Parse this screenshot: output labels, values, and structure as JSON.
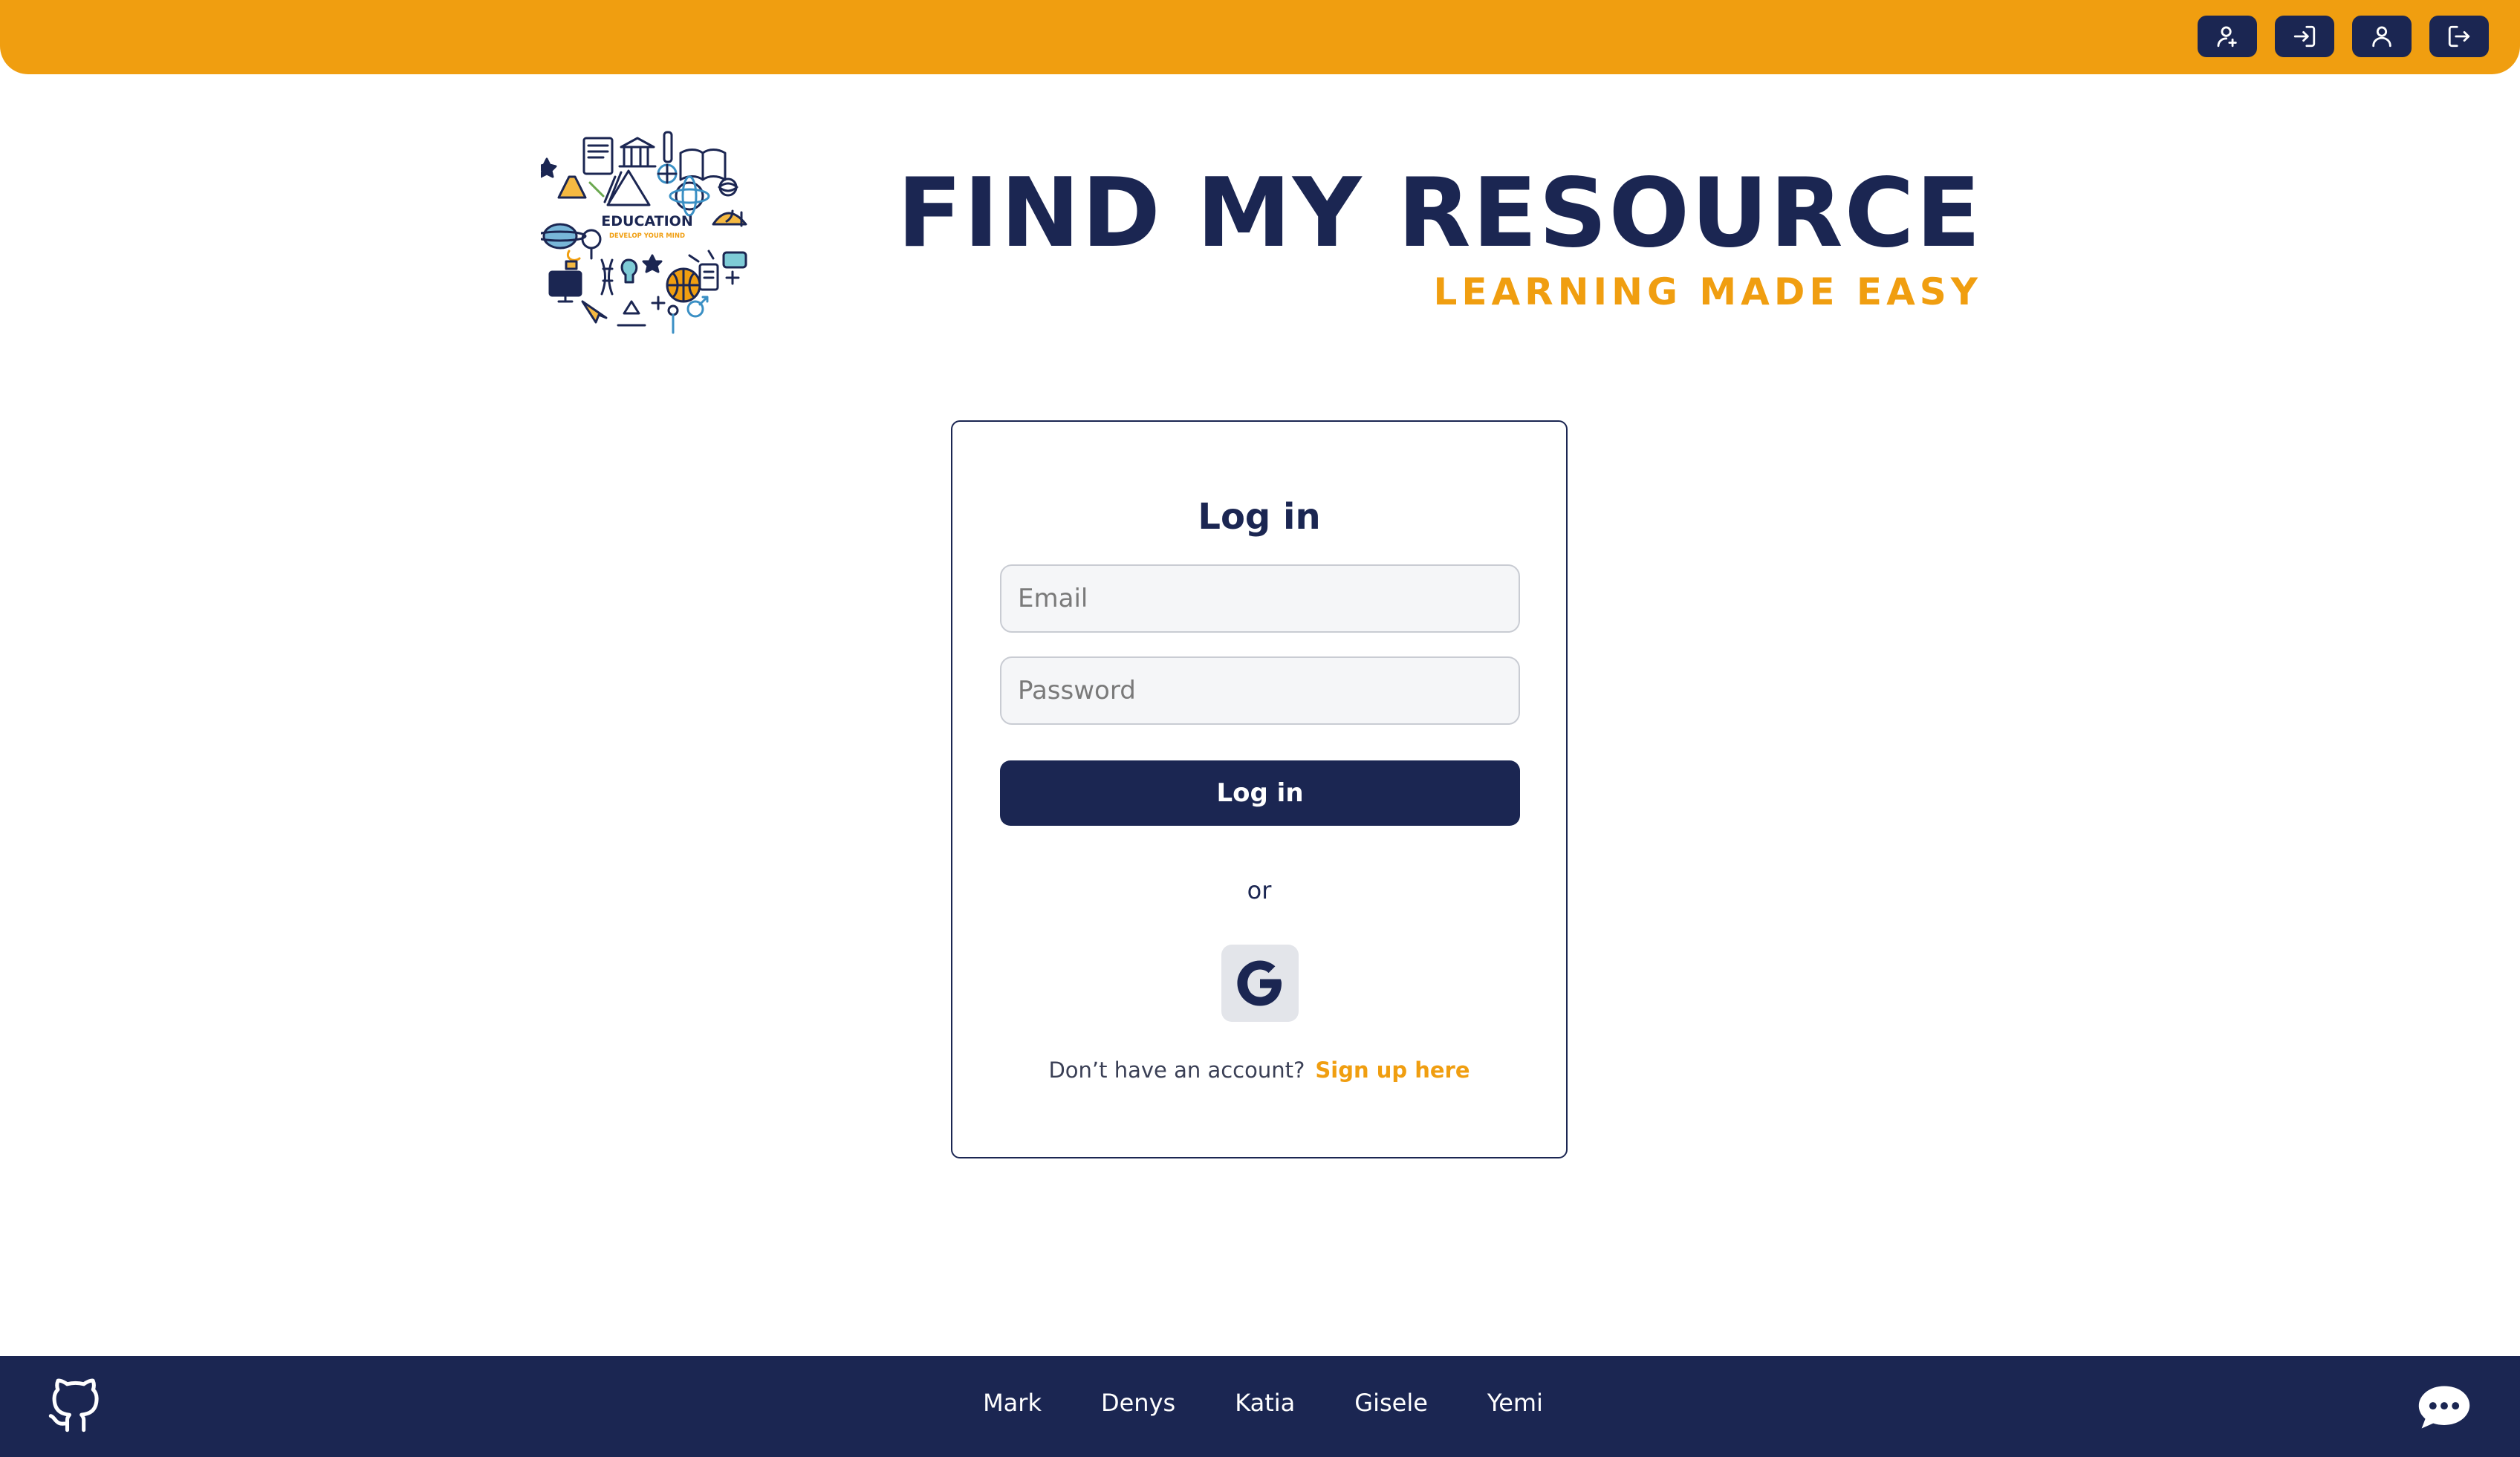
{
  "topbar": {
    "buttons": [
      {
        "icon": "user-plus-icon"
      },
      {
        "icon": "sign-in-icon"
      },
      {
        "icon": "user-icon"
      },
      {
        "icon": "sign-out-icon"
      }
    ]
  },
  "logo": {
    "text": "EDUCATION",
    "tagline": "DEVELOP YOUR MIND"
  },
  "brand": {
    "title": "FIND MY RESOURCE",
    "subtitle": "LEARNING MADE EASY"
  },
  "login": {
    "title": "Log in",
    "email_placeholder": "Email",
    "password_placeholder": "Password",
    "submit_label": "Log in",
    "or_text": "or",
    "google_icon": "google-icon",
    "signup_prompt": "Don’t have an account?",
    "signup_link": "Sign up here"
  },
  "footer": {
    "github_icon": "github-icon",
    "chat_icon": "chat-icon",
    "links": [
      "Mark",
      "Denys",
      "Katia",
      "Gisele",
      "Yemi"
    ]
  },
  "colors": {
    "accent": "#f09e10",
    "navy": "#1b2652",
    "field_bg": "#f5f6f8"
  }
}
